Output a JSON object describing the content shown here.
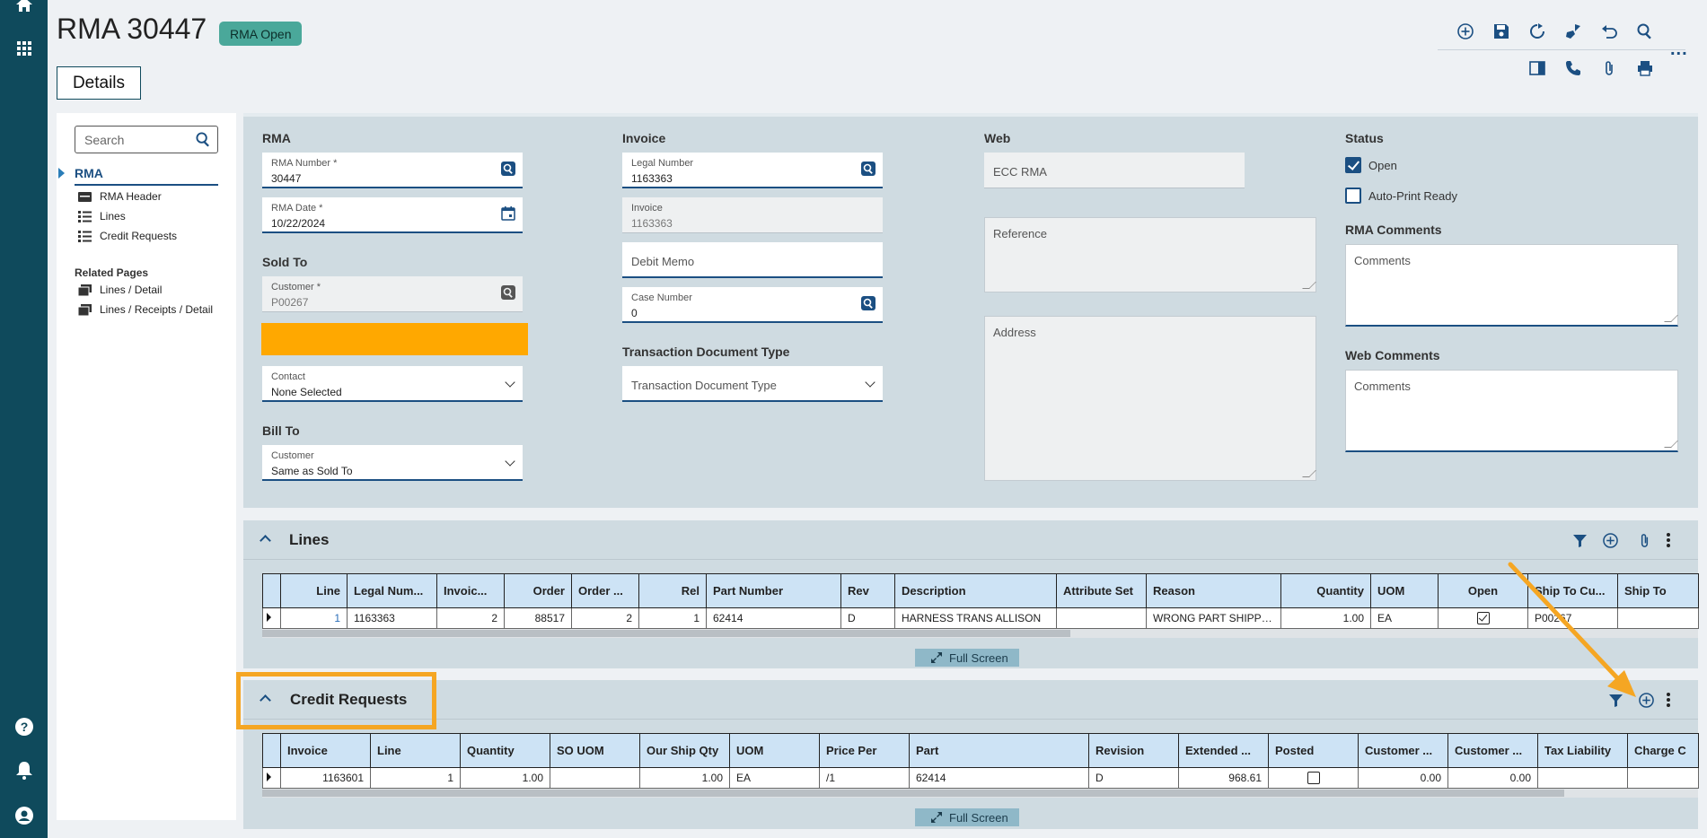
{
  "header": {
    "title": "RMA 30447",
    "status": "RMA Open",
    "tab": "Details"
  },
  "toolbar": {
    "row1": [
      "add-icon",
      "save-icon",
      "refresh-icon",
      "clear-icon",
      "undo-icon",
      "search-icon"
    ],
    "row2": [
      "panel-icon",
      "phone-icon",
      "attachment-icon",
      "print-icon"
    ],
    "more": "..."
  },
  "nav": {
    "search_placeholder": "Search",
    "active": "RMA",
    "items": [
      "RMA Header",
      "Lines",
      "Credit Requests"
    ],
    "related_title": "Related Pages",
    "related": [
      "Lines / Detail",
      "Lines / Receipts / Detail"
    ]
  },
  "form": {
    "rma": {
      "label": "RMA",
      "number_label": "RMA Number *",
      "number_value": "30447",
      "date_label": "RMA Date *",
      "date_value": "10/22/2024"
    },
    "sold_to": {
      "label": "Sold To",
      "customer_label": "Customer *",
      "customer_value": "P00267",
      "contact_label": "Contact",
      "contact_value": "None Selected"
    },
    "bill_to": {
      "label": "Bill To",
      "customer_label": "Customer",
      "customer_value": "Same as Sold To"
    },
    "invoice": {
      "label": "Invoice",
      "legal_label": "Legal Number",
      "legal_value": "1163363",
      "invoice_label": "Invoice",
      "invoice_value": "1163363",
      "debit_placeholder": "Debit Memo",
      "case_label": "Case Number",
      "case_value": "0"
    },
    "tdt": {
      "label": "Transaction Document Type",
      "placeholder": "Transaction Document Type"
    },
    "web": {
      "label": "Web",
      "ecc_placeholder": "ECC RMA",
      "reference_placeholder": "Reference",
      "address_placeholder": "Address"
    },
    "status": {
      "label": "Status",
      "open_label": "Open",
      "open_checked": true,
      "autoprint_label": "Auto-Print Ready",
      "autoprint_checked": false,
      "rma_comments_label": "RMA Comments",
      "rma_comments_placeholder": "Comments",
      "web_comments_label": "Web Comments",
      "web_comments_placeholder": "Comments"
    }
  },
  "lines": {
    "title": "Lines",
    "columns": [
      "Line",
      "Legal Num...",
      "Invoic...",
      "Order",
      "Order ...",
      "Rel",
      "Part Number",
      "Rev",
      "Description",
      "Attribute Set",
      "Reason",
      "Quantity",
      "UOM",
      "Open",
      "Ship To Cu...",
      "Ship To"
    ],
    "row": {
      "line": "1",
      "legal": "1163363",
      "invoice": "2",
      "order": "88517",
      "order_line": "2",
      "rel": "1",
      "part": "62414",
      "rev": "D",
      "description": "HARNESS TRANS ALLISON",
      "attribute": "",
      "reason": "WRONG PART SHIPPED",
      "quantity": "1.00",
      "uom": "EA",
      "open": true,
      "ship_to_cust": "P00267",
      "ship_to": ""
    },
    "fullscreen": "Full Screen"
  },
  "credit": {
    "title": "Credit Requests",
    "columns": [
      "Invoice",
      "Line",
      "Quantity",
      "SO UOM",
      "Our Ship Qty",
      "UOM",
      "Price Per",
      "Part",
      "Revision",
      "Extended ...",
      "Posted",
      "Customer ...",
      "Customer ...",
      "Tax Liability",
      "Charge C"
    ],
    "row": {
      "invoice": "1163601",
      "line": "1",
      "quantity": "1.00",
      "so_uom": "",
      "ship_qty": "1.00",
      "uom": "EA",
      "price_per": "/1",
      "part": "62414",
      "revision": "D",
      "extended": "968.61",
      "posted": false,
      "cust1": "0.00",
      "cust2": "0.00",
      "tax": "",
      "charge": ""
    },
    "fullscreen": "Full Screen"
  },
  "colors": {
    "rail": "#0f4a5c",
    "accent": "#1b4f82",
    "status_pill": "#4aa89a",
    "highlight": "#f5a623",
    "warning_bar": "#ffa800"
  }
}
